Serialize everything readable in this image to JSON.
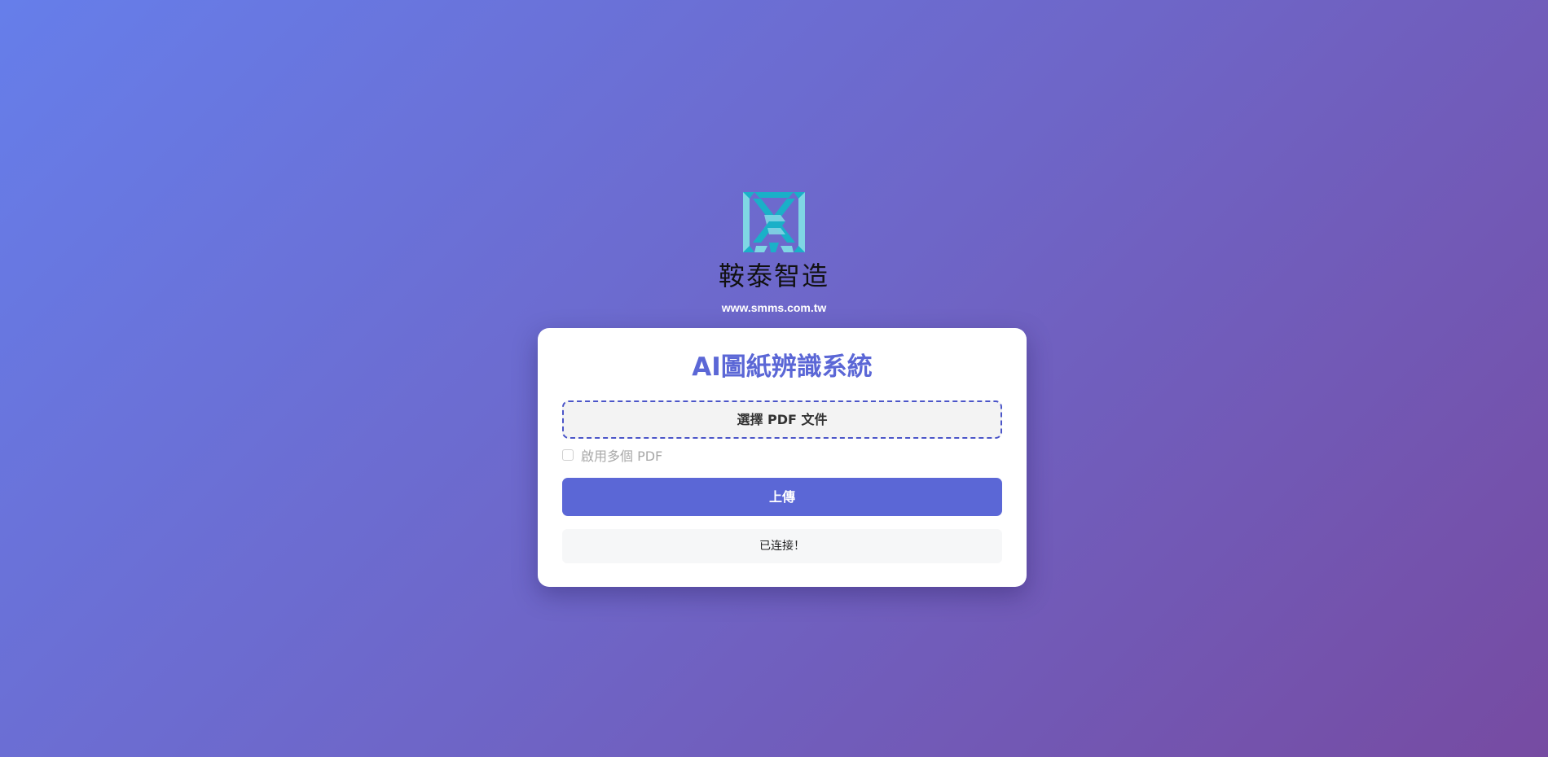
{
  "brand": {
    "logo_icon": "smms-logo-icon",
    "name": "鞍泰智造",
    "url": "www.smms.com.tw"
  },
  "card": {
    "title": "AI圖紙辨識系統",
    "file_picker_label": "選擇 PDF 文件",
    "multi_pdf_label": "啟用多個 PDF",
    "multi_pdf_checked": false,
    "upload_label": "上傳",
    "status_text": "已连接！"
  },
  "colors": {
    "accent": "#5b67d6",
    "logo_teal": "#1ab0c8",
    "background_start": "#667eea",
    "background_end": "#764ba2"
  }
}
